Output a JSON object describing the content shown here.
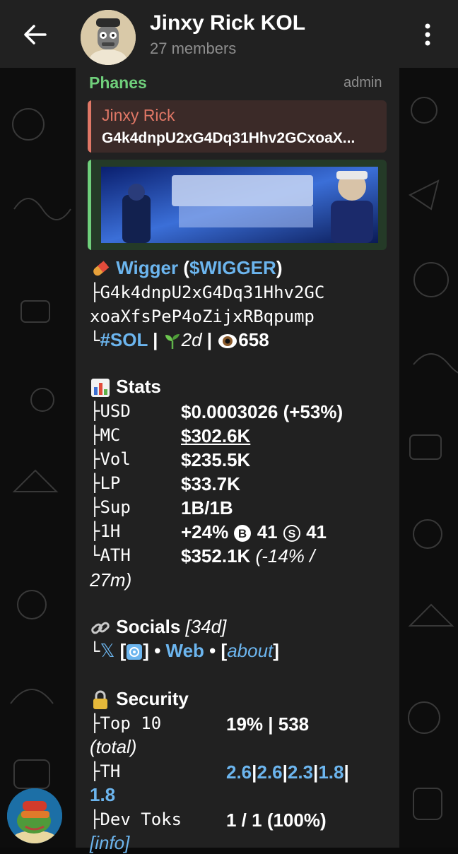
{
  "header": {
    "back_icon": "arrow-left-icon",
    "title": "Jinxy Rick KOL",
    "subtitle": "27 members",
    "menu_icon": "more-vertical-icon"
  },
  "message": {
    "sender": "Phanes",
    "role": "admin",
    "reply": {
      "name": "Jinxy Rick",
      "text": "G4k4dnpU2xG4Dq31Hhv2GCxoaX..."
    },
    "token": {
      "name": "Wigger",
      "ticker_open": " (",
      "ticker": "$WIGGER",
      "ticker_close": ")",
      "address_line1": "├G4k4dnpU2xG4Dq31Hhv2GC",
      "address_line2": "xoaXfsPeP4oZijxRBqpump",
      "tree_end": "└",
      "chain": "#SOL",
      "sep": " | ",
      "age": "2d",
      "views": "658"
    },
    "stats": {
      "heading": "Stats",
      "rows": [
        {
          "tree": "├",
          "label": "USD",
          "value": "$0.0003026 (+53%)"
        },
        {
          "tree": "├",
          "label": "MC",
          "value": "$302.6K"
        },
        {
          "tree": "├",
          "label": "Vol",
          "value": "$235.5K"
        },
        {
          "tree": "├",
          "label": "LP",
          "value": "$33.7K"
        },
        {
          "tree": "├",
          "label": "Sup",
          "value": "1B/1B"
        },
        {
          "tree": "├",
          "label": "1H",
          "value": "+24%",
          "buys": "41",
          "sells": "41"
        },
        {
          "tree": "└",
          "label": "ATH",
          "value": "$352.1K",
          "ath_note1": "(-14% /",
          "ath_note2": "27m)"
        }
      ]
    },
    "socials": {
      "heading": "Socials",
      "age": "[34d]",
      "tree": "└",
      "x_glyph": "𝕏",
      "x_bracket_open": " [",
      "x_bracket_close": "]",
      "bullet": " • ",
      "web": "Web",
      "about_open": "[",
      "about": "about",
      "about_close": "]"
    },
    "security": {
      "heading": "Security",
      "top10_label": "├Top 10",
      "top10_value": "19% | 538",
      "top10_note": "(total)",
      "th_label": "├TH",
      "th_values": [
        "2.6",
        "2.6",
        "2.3",
        "1.8"
      ],
      "th_last": "1.8",
      "th_sep": "|",
      "dev_label": "├Dev Toks",
      "dev_value": "1 / 1 (100%)",
      "info": "[info]"
    }
  },
  "colors": {
    "header_bg": "#212121",
    "bubble_bg": "#212121",
    "sender": "#6fcf7b",
    "reply_name": "#e07766",
    "link": "#6cb5ee",
    "muted": "#8e8e8e"
  }
}
